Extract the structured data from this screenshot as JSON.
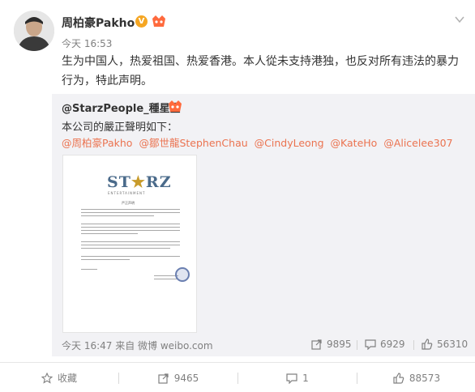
{
  "post": {
    "username": "周柏豪Pakho",
    "time": "今天 16:53",
    "text": "生为中国人，热爱祖国、热爱香港。本人從未支持港独，也反对所有违法的暴力行为，特此声明。"
  },
  "repost": {
    "username": "@StarzPeople_種星堂",
    "text": "本公司的嚴正聲明如下：",
    "mentions": [
      "@周柏豪Pakho",
      "@鄒世龍StephenChau",
      "@CindyLeong",
      "@KateHo",
      "@Alicelee307"
    ],
    "image": {
      "logo": "STARZ",
      "logo_sub": "ENTERTAINMENT",
      "doc_title": "严正声明"
    },
    "footer": "今天 16:47 来自 微博 weibo.com",
    "stats": {
      "reposts": "9895",
      "comments": "6929",
      "likes": "56310"
    }
  },
  "actions": {
    "favorite": "收藏",
    "repost": "9465",
    "comment": "1",
    "like": "88573"
  },
  "colors": {
    "mention": "#eb7350",
    "muted": "#808080",
    "repost_bg": "#f2f2f5",
    "badge": "#f5a623"
  }
}
